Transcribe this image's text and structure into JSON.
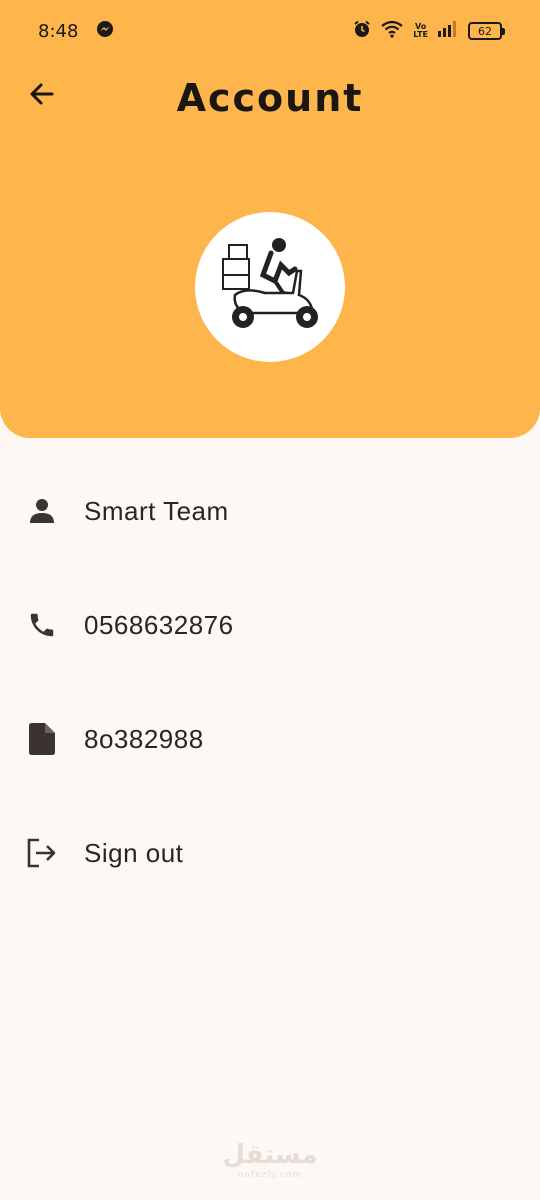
{
  "status_bar": {
    "time": "8:48",
    "battery": "62",
    "network": "Vo LTE"
  },
  "header": {
    "title": "Account",
    "background_color": "#fdb54c"
  },
  "profile": {
    "avatar_alt": "delivery scooter rider"
  },
  "list": {
    "items": [
      {
        "icon": "person-icon",
        "label": "Smart Team"
      },
      {
        "icon": "phone-icon",
        "label": "0568632876"
      },
      {
        "icon": "document-icon",
        "label": "8o382988"
      },
      {
        "icon": "logout-icon",
        "label": "Sign out"
      }
    ]
  },
  "watermark": {
    "text": "مستقل",
    "sub": "nafezly.com"
  }
}
